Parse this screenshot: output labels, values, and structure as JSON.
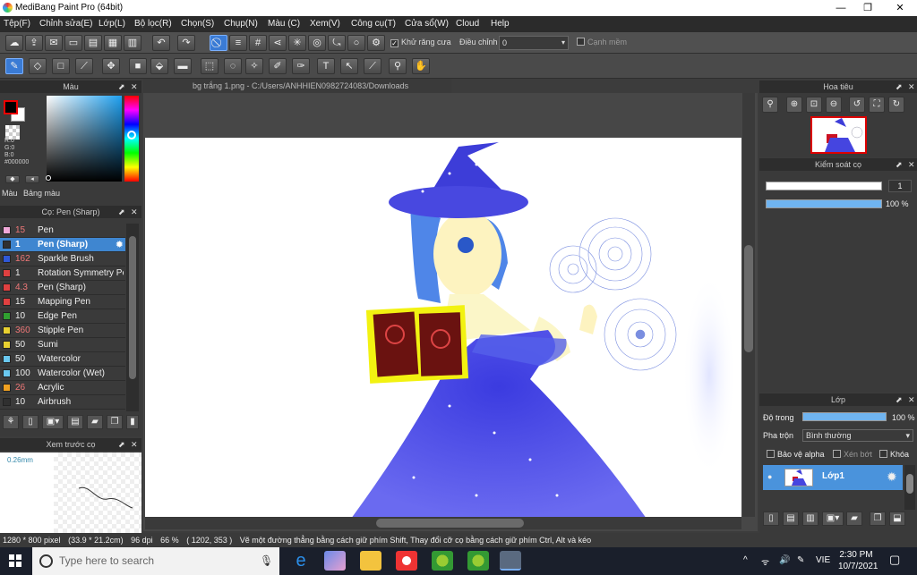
{
  "window": {
    "title": "MediBang Paint Pro (64bit)",
    "min_label": "—",
    "max_label": "❐",
    "close_label": "✕"
  },
  "menu": [
    "Tệp(F)",
    "Chỉnh sửa(E)",
    "Lớp(L)",
    "Bộ lọc(R)",
    "Chọn(S)",
    "Chụp(N)",
    "Màu (C)",
    "Xem(V)",
    "Công cụ(T)",
    "Cửa sổ(W)",
    "Cloud",
    "Help"
  ],
  "toolbar": {
    "antialias_label": "Khử răng cưa",
    "adjust_label": "Điều chỉnh",
    "adjust_value": "0",
    "smooth_label": "Cạnh mềm"
  },
  "color_panel": {
    "title": "Màu",
    "rgb_readout": "R:0\nG:0\nB:0\n#000000",
    "tab_color": "Màu",
    "tab_palette": "Bảng màu",
    "fg_color": "#000000",
    "bg_color": "#ffffff"
  },
  "brush_panel": {
    "title": "Cọ: Pen (Sharp)",
    "items": [
      {
        "size": "15",
        "name": "Pen",
        "color": "#f0a8d8",
        "size_color": "red"
      },
      {
        "size": "1",
        "name": "Pen (Sharp)",
        "color": "#303030",
        "size_color": "white",
        "selected": true
      },
      {
        "size": "162",
        "name": "Sparkle Brush",
        "color": "#2f58d8",
        "size_color": "red"
      },
      {
        "size": "1",
        "name": "Rotation Symmetry Pen",
        "color": "#e04040",
        "size_color": "white"
      },
      {
        "size": "4.3",
        "name": "Pen (Sharp)",
        "color": "#e04040",
        "size_color": "red"
      },
      {
        "size": "15",
        "name": "Mapping Pen",
        "color": "#e04040",
        "size_color": "white"
      },
      {
        "size": "10",
        "name": "Edge Pen",
        "color": "#30a030",
        "size_color": "white"
      },
      {
        "size": "360",
        "name": "Stipple Pen",
        "color": "#e8d030",
        "size_color": "red"
      },
      {
        "size": "50",
        "name": "Sumi",
        "color": "#e8d030",
        "size_color": "white"
      },
      {
        "size": "50",
        "name": "Watercolor",
        "color": "#6ac8f0",
        "size_color": "white"
      },
      {
        "size": "100",
        "name": "Watercolor (Wet)",
        "color": "#6ac8f0",
        "size_color": "white"
      },
      {
        "size": "26",
        "name": "Acrylic",
        "color": "#f0a020",
        "size_color": "red"
      },
      {
        "size": "10",
        "name": "Airbrush",
        "color": "#303030",
        "size_color": "white"
      }
    ]
  },
  "preview_panel": {
    "title": "Xem trước cọ",
    "size_label": "0.26mm"
  },
  "document": {
    "tab_title": "bg trắng 1.png - C:/Users/ANHHIEN0982724083/Downloads"
  },
  "status": {
    "dimensions": "1280 * 800 pixel",
    "physical": "(33.9 * 21.2cm)",
    "dpi": "96 dpi",
    "zoom": "66 %",
    "coords": "( 1202, 353 )",
    "hint": "Vẽ một đường thẳng bằng cách giữ phím Shift, Thay đổi cỡ cọ bằng cách giữ phím Ctrl, Alt và kéo"
  },
  "navigator": {
    "title": "Hoa tiêu"
  },
  "brush_control": {
    "title": "Kiểm soát cọ",
    "size_value": "1",
    "opacity_value": "100 %",
    "opacity_fraction": 1.0
  },
  "layer_panel": {
    "title": "Lớp",
    "opacity_label": "Độ trong",
    "opacity_value": "100 %",
    "blend_label": "Pha trộn",
    "blend_value": "Bình thường",
    "protect_label": "Bảo vệ alpha",
    "clip_label": "Xén bớt",
    "lock_label": "Khóa",
    "layer_name": "Lớp1"
  },
  "taskbar": {
    "search_placeholder": "Type here to search",
    "language": "VIE",
    "time": "2:30 PM",
    "date": "10/7/2021"
  }
}
